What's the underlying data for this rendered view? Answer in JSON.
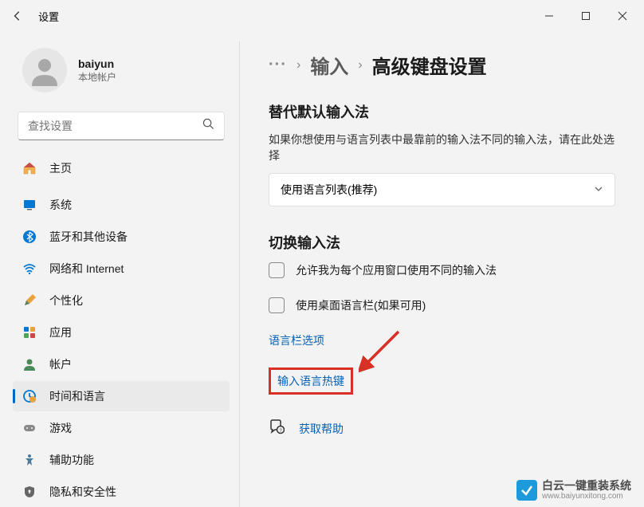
{
  "titlebar": {
    "title": "设置"
  },
  "user": {
    "name": "baiyun",
    "sub": "本地帐户"
  },
  "search": {
    "placeholder": "查找设置"
  },
  "nav": {
    "home": "主页",
    "system": "系统",
    "bluetooth": "蓝牙和其他设备",
    "network": "网络和 Internet",
    "personalize": "个性化",
    "apps": "应用",
    "accounts": "帐户",
    "time_lang": "时间和语言",
    "gaming": "游戏",
    "accessibility": "辅助功能",
    "privacy": "隐私和安全性"
  },
  "breadcrumb": {
    "dots": "···",
    "prev": "输入",
    "current": "高级键盘设置"
  },
  "override": {
    "title": "替代默认输入法",
    "desc": "如果你想使用与语言列表中最靠前的输入法不同的输入法，请在此处选择",
    "selected": "使用语言列表(推荐)"
  },
  "switch": {
    "title": "切换输入法",
    "check1": "允许我为每个应用窗口使用不同的输入法",
    "check2": "使用桌面语言栏(如果可用)",
    "link1": "语言栏选项",
    "link2": "输入语言热键"
  },
  "help": {
    "label": "获取帮助"
  },
  "watermark": {
    "title": "白云一键重装系统",
    "url": "www.baiyunxitong.com"
  }
}
